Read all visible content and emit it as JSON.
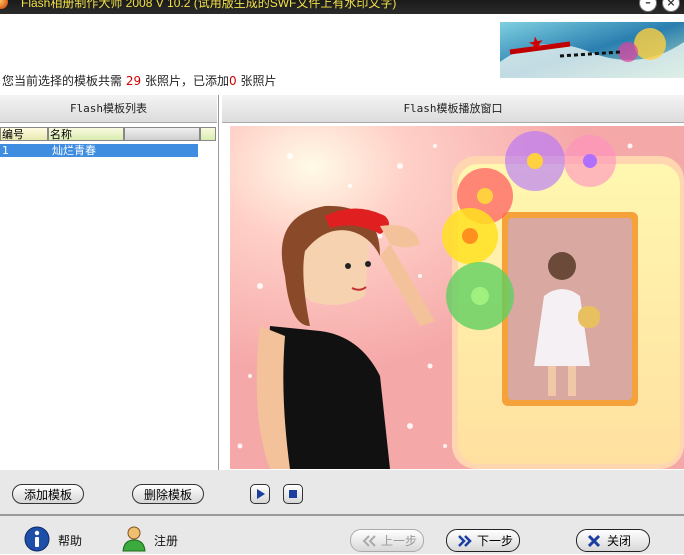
{
  "window": {
    "title": "Flash相册制作大师 2008 V 10.2 (试用版生成的SWF文件上有水印文字)",
    "minimize_glyph": "–",
    "close_glyph": "×"
  },
  "status": {
    "prefix": "您当前选择的模板共需",
    "required_count": "29",
    "middle": "张照片，已添加",
    "added_count": "0",
    "suffix": "张照片"
  },
  "template_list": {
    "title": "Flash模板列表",
    "columns": [
      "编号",
      "名称"
    ],
    "rows": [
      {
        "id": "1",
        "name": "灿烂青春"
      }
    ],
    "add_label": "添加模板",
    "delete_label": "删除模板"
  },
  "player": {
    "title": "Flash模板播放窗口"
  },
  "footer": {
    "help_label": "帮助",
    "register_label": "注册",
    "prev_label": "上一步",
    "next_label": "下一步",
    "close_label": "关闭"
  },
  "colors": {
    "accent_blue": "#3f8de0",
    "count_red": "#d00000",
    "title_yellow": "#f2e04a"
  }
}
